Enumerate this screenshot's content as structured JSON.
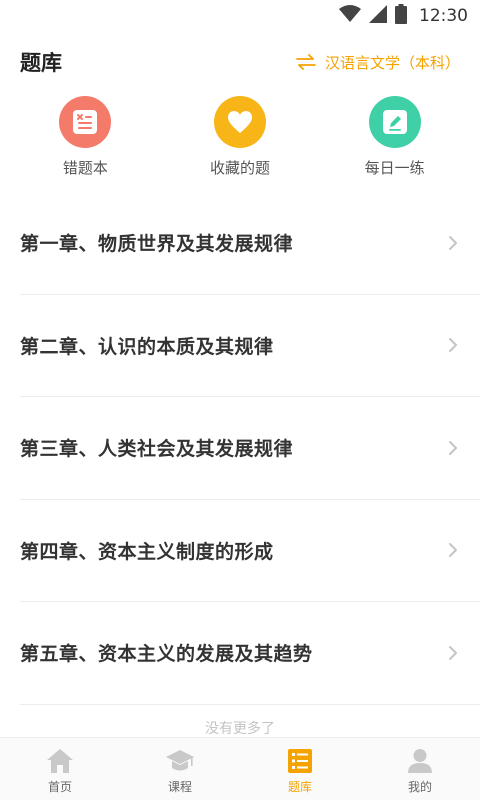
{
  "status_bar": {
    "time": "12:30",
    "icons": [
      "wifi-icon",
      "signal-icon",
      "battery-icon"
    ]
  },
  "header": {
    "title": "题库",
    "subject": "汉语言文学（本科）",
    "swap_icon": "swap-icon"
  },
  "quick_actions": [
    {
      "label": "错题本",
      "icon": "wrong-book-icon",
      "color": "#f47a6a"
    },
    {
      "label": "收藏的题",
      "icon": "heart-icon",
      "color": "#f7b518"
    },
    {
      "label": "每日一练",
      "icon": "pencil-icon",
      "color": "#3fd0a8"
    }
  ],
  "chapters": [
    {
      "title": "第一章、物质世界及其发展规律"
    },
    {
      "title": "第二章、认识的本质及其规律"
    },
    {
      "title": "第三章、人类社会及其发展规律"
    },
    {
      "title": "第四章、资本主义制度的形成"
    },
    {
      "title": "第五章、资本主义的发展及其趋势"
    }
  ],
  "footer_text": "没有更多了",
  "bottom_nav": [
    {
      "label": "首页",
      "icon": "home-icon",
      "active": false
    },
    {
      "label": "课程",
      "icon": "graduation-cap-icon",
      "active": false
    },
    {
      "label": "题库",
      "icon": "question-bank-icon",
      "active": true
    },
    {
      "label": "我的",
      "icon": "user-icon",
      "active": false
    }
  ],
  "colors": {
    "accent": "#f5a300",
    "nav_inactive": "#c9c9c9"
  }
}
